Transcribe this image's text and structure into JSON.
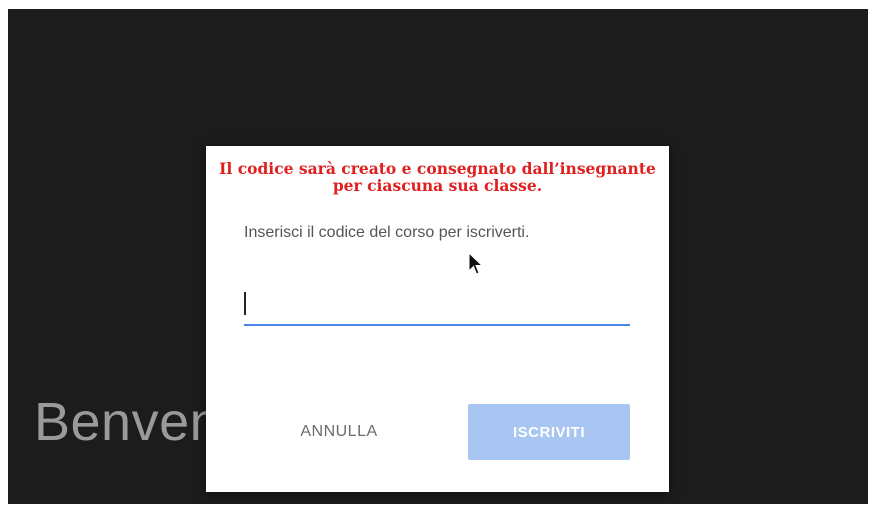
{
  "background": {
    "welcome_text": "Benvenuto in Classroom!"
  },
  "dialog": {
    "note": "Il codice sarà creato e consegnato dall’insegnante per ciascuna sua classe.",
    "prompt": "Inserisci il codice del corso per iscriverti.",
    "code_input": {
      "value": "",
      "placeholder": ""
    },
    "cancel_label": "ANNULLA",
    "join_label": "ISCRIVITI"
  },
  "colors": {
    "accent": "#4a86e8",
    "join_disabled": "#a9c5f1",
    "note_red": "#e02020",
    "backdrop": "#1c1c1c"
  },
  "icons": {
    "pointer": "mouse-pointer-icon"
  }
}
